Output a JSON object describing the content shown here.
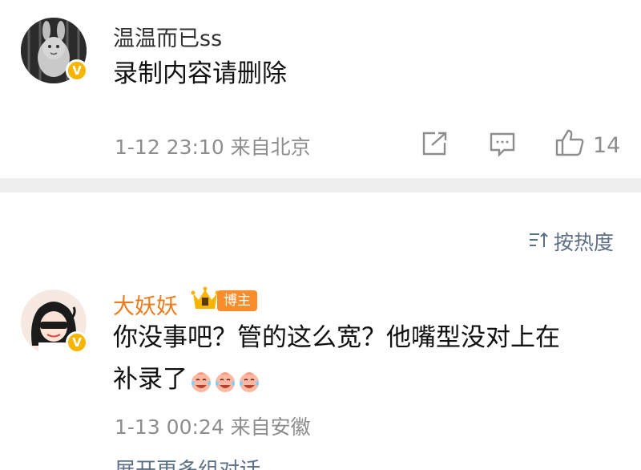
{
  "comment1": {
    "username": "温温而已ss",
    "text": "录制内容请删除",
    "meta": "1-12 23:10 来自北京",
    "like_count": "14",
    "icons": [
      "share-icon",
      "comment-icon",
      "like-icon"
    ]
  },
  "sort": {
    "label": "按热度",
    "icon": "sort-icon"
  },
  "comment2": {
    "username": "大妖妖",
    "badge": "博主",
    "text_line1": "你没事吧？管的这么宽？他嘴型没对上在",
    "text_line2": "补录了",
    "meta": "1-13 00:24 来自安徽",
    "emoji_icons": [
      "laugh-cry-emoji",
      "laugh-cry-emoji",
      "laugh-cry-emoji"
    ]
  },
  "expand": {
    "label": "展开更多组对话"
  },
  "colors": {
    "verified_badge": "#f7b500",
    "blogger_badge": "#f98d2b",
    "username_orange": "#ef7a1a",
    "link_blue_gray": "#5d6f84",
    "meta_gray": "#8d8d8d",
    "divider": "#eeeeee"
  }
}
